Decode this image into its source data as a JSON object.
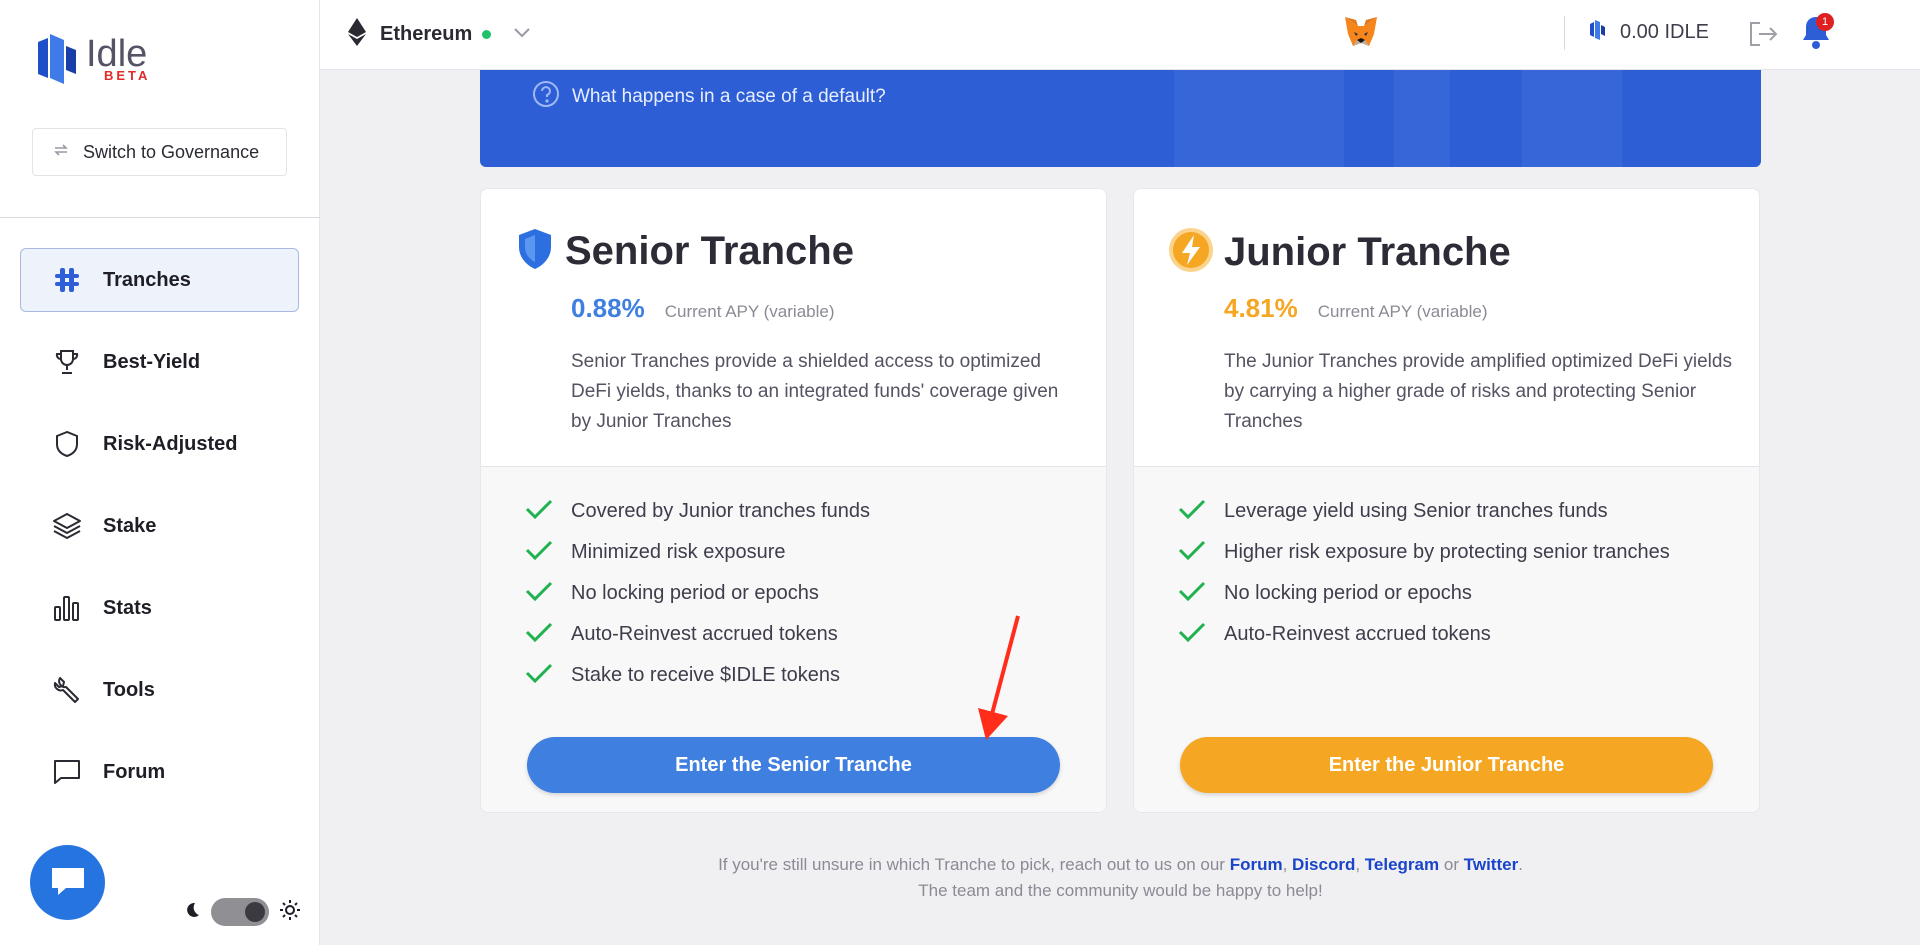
{
  "sidebar": {
    "logo": {
      "word": "Idle",
      "tag": "BETA"
    },
    "governance_button": "Switch to Governance",
    "nav": [
      {
        "label": "Tranches",
        "icon": "tranches-icon",
        "active": true
      },
      {
        "label": "Best-Yield",
        "icon": "trophy-icon"
      },
      {
        "label": "Risk-Adjusted",
        "icon": "shield-icon"
      },
      {
        "label": "Stake",
        "icon": "layers-icon"
      },
      {
        "label": "Stats",
        "icon": "bar-chart-icon"
      },
      {
        "label": "Tools",
        "icon": "wrench-icon"
      },
      {
        "label": "Forum",
        "icon": "chat-bubble-icon"
      }
    ]
  },
  "topbar": {
    "network": "Ethereum",
    "network_status_color": "#1fc16b",
    "balance": "0.00 IDLE",
    "notifications": "1"
  },
  "banner": {
    "question": "What happens in a case of a default?"
  },
  "senior": {
    "title": "Senior Tranche",
    "apy": "0.88%",
    "apy_label": "Current APY (variable)",
    "description": "Senior Tranches provide a shielded access to optimized DeFi yields, thanks to an integrated funds' coverage given by Junior Tranches",
    "features": [
      "Covered by Junior tranches funds",
      "Minimized risk exposure",
      "No locking period or epochs",
      "Auto-Reinvest accrued tokens",
      "Stake to receive $IDLE tokens"
    ],
    "cta": "Enter the Senior Tranche",
    "color": "#3f7fe0"
  },
  "junior": {
    "title": "Junior Tranche",
    "apy": "4.81%",
    "apy_label": "Current APY (variable)",
    "description": "The Junior Tranches provide amplified optimized DeFi yields by carrying a higher grade of risks and protecting Senior Tranches",
    "features": [
      "Leverage yield using Senior tranches funds",
      "Higher risk exposure by protecting senior tranches",
      "No locking period or epochs",
      "Auto-Reinvest accrued tokens"
    ],
    "cta": "Enter the Junior Tranche",
    "color": "#f5a623"
  },
  "footer": {
    "line1_prefix": "If you're still unsure in which Tranche to pick, reach out to us on our",
    "links": [
      "Forum",
      "Discord",
      "Telegram",
      "Twitter"
    ],
    "or": "or",
    "line2": "The team and the community would be happy to help!"
  }
}
